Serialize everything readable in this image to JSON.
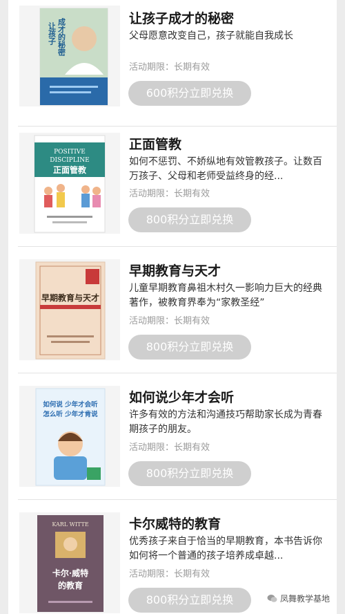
{
  "items": [
    {
      "title": "让孩子成才的秘密",
      "description": "父母愿意改变自己，孩子就能自我成长",
      "period": "活动期限：长期有效",
      "button": "600积分立即兑换",
      "cover": {
        "title": "让孩子成才的秘密",
        "bg": "#2a6aa9"
      }
    },
    {
      "title": "正面管教",
      "description": "如何不惩罚、不娇纵地有效管教孩子。让数百万孩子、父母和老师受益终身的经...",
      "period": "活动期限：长期有效",
      "button": "800积分立即兑换",
      "cover": {
        "title_en": "POSITIVE DISCIPLINE",
        "title_cn": "正面管教",
        "bg": "#2d8b83"
      }
    },
    {
      "title": "早期教育与天才",
      "description": "儿童早期教育鼻祖木村久一影响力巨大的经典著作，被教育界奉为“家教圣经”",
      "period": "活动期限：长期有效",
      "button": "800积分立即兑换",
      "cover": {
        "title": "早期教育与天才",
        "bg": "#f3ddc8"
      }
    },
    {
      "title": "如何说少年才会听",
      "description": "许多有效的方法和沟通技巧帮助家长成为青春期孩子的朋友。",
      "period": "活动期限：长期有效",
      "button": "800积分立即兑换",
      "cover": {
        "line1": "如何说 少年才会听",
        "line2": "怎么听 少年才肯说",
        "bg": "#e9f3fb"
      }
    },
    {
      "title": "卡尔威特的教育",
      "description": "优秀孩子来自于恰当的早期教育，本书告诉你如何将一个普通的孩子培养成卓越...",
      "period": "活动期限：长期有效",
      "button": "800积分立即兑换",
      "cover": {
        "title_en": "KARL WITTE",
        "title_cn": "卡尔·威特的教育",
        "bg": "#6f5666"
      }
    }
  ],
  "watermark": "凤舞教学基地"
}
